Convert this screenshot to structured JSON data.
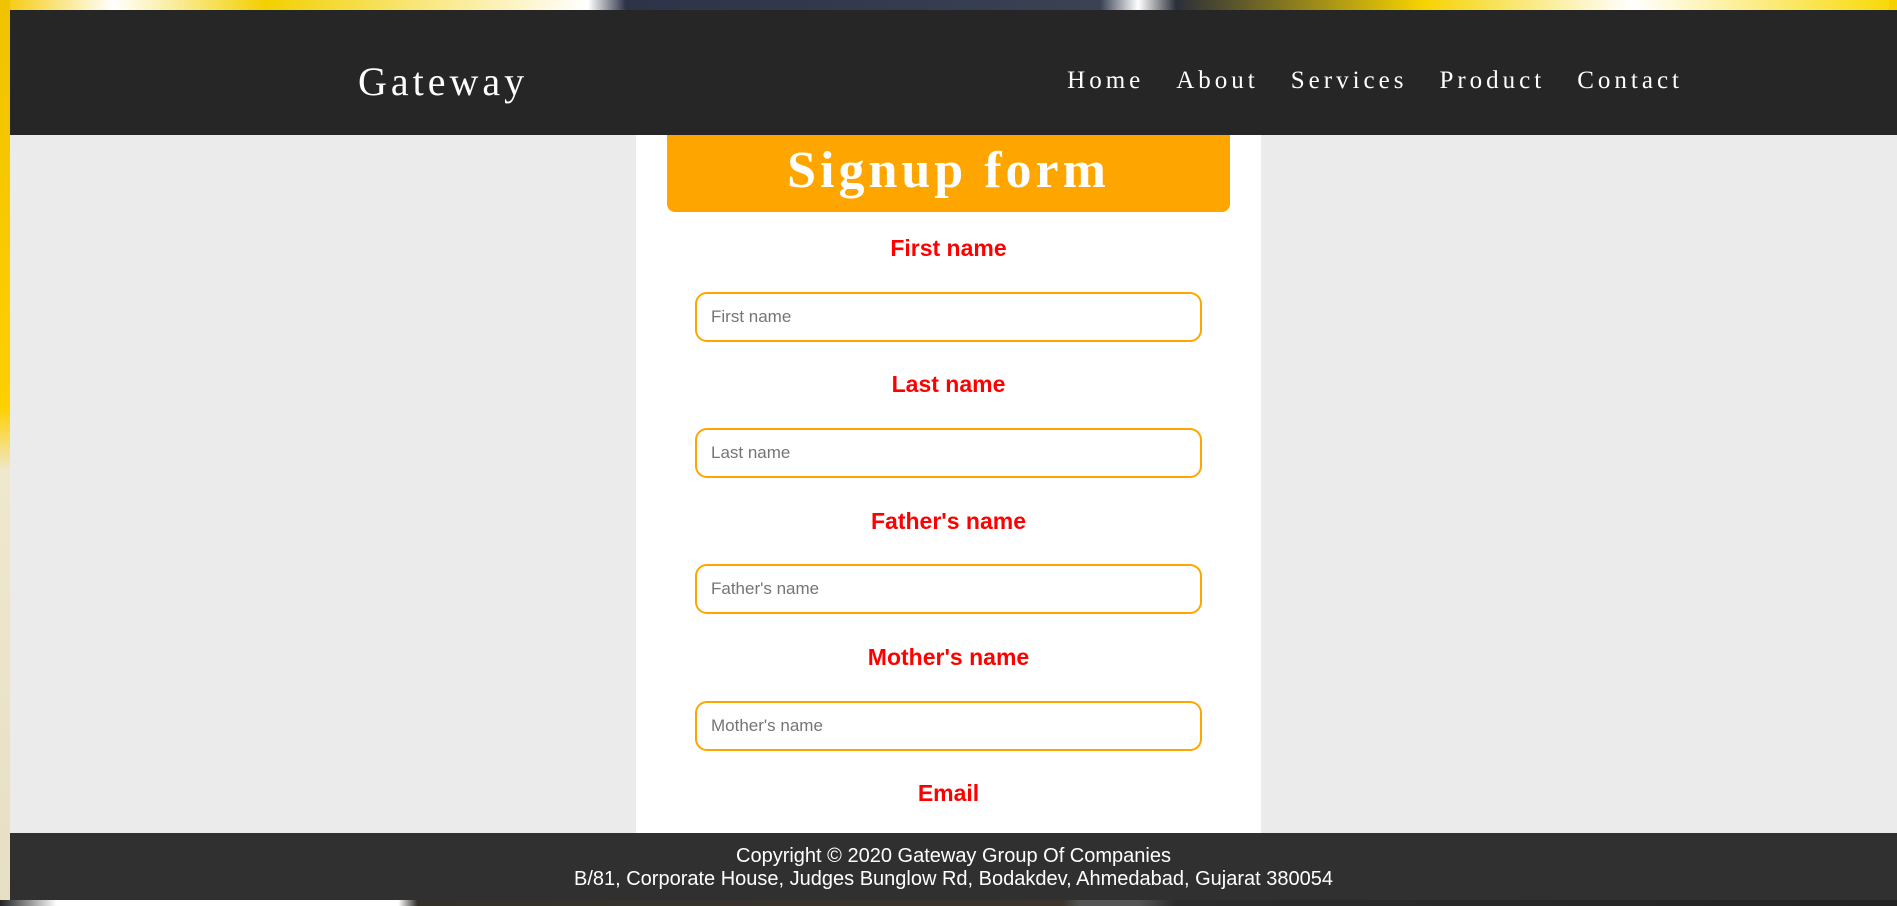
{
  "navbar": {
    "brand": "Gateway",
    "links": [
      "Home",
      "About",
      "Services",
      "Product",
      "Contact"
    ]
  },
  "form": {
    "title": "Signup form",
    "fields": [
      {
        "label": "First name",
        "placeholder": "First name",
        "value": ""
      },
      {
        "label": "Last name",
        "placeholder": "Last name",
        "value": ""
      },
      {
        "label": "Father's name",
        "placeholder": "Father's name",
        "value": ""
      },
      {
        "label": "Mother's name",
        "placeholder": "Mother's name",
        "value": ""
      },
      {
        "label": "Email"
      }
    ]
  },
  "footer": {
    "copyright": "Copyright © 2020 Gateway Group Of Companies",
    "address": "B/81, Corporate House, Judges Bunglow Rd, Bodakdev, Ahmedabad, Gujarat 380054"
  },
  "colors": {
    "navbar_bg": "#262626",
    "accent": "#ffa500",
    "label": "#ff0000",
    "footer_bg": "#303030",
    "page_bg": "#ebebeb"
  }
}
